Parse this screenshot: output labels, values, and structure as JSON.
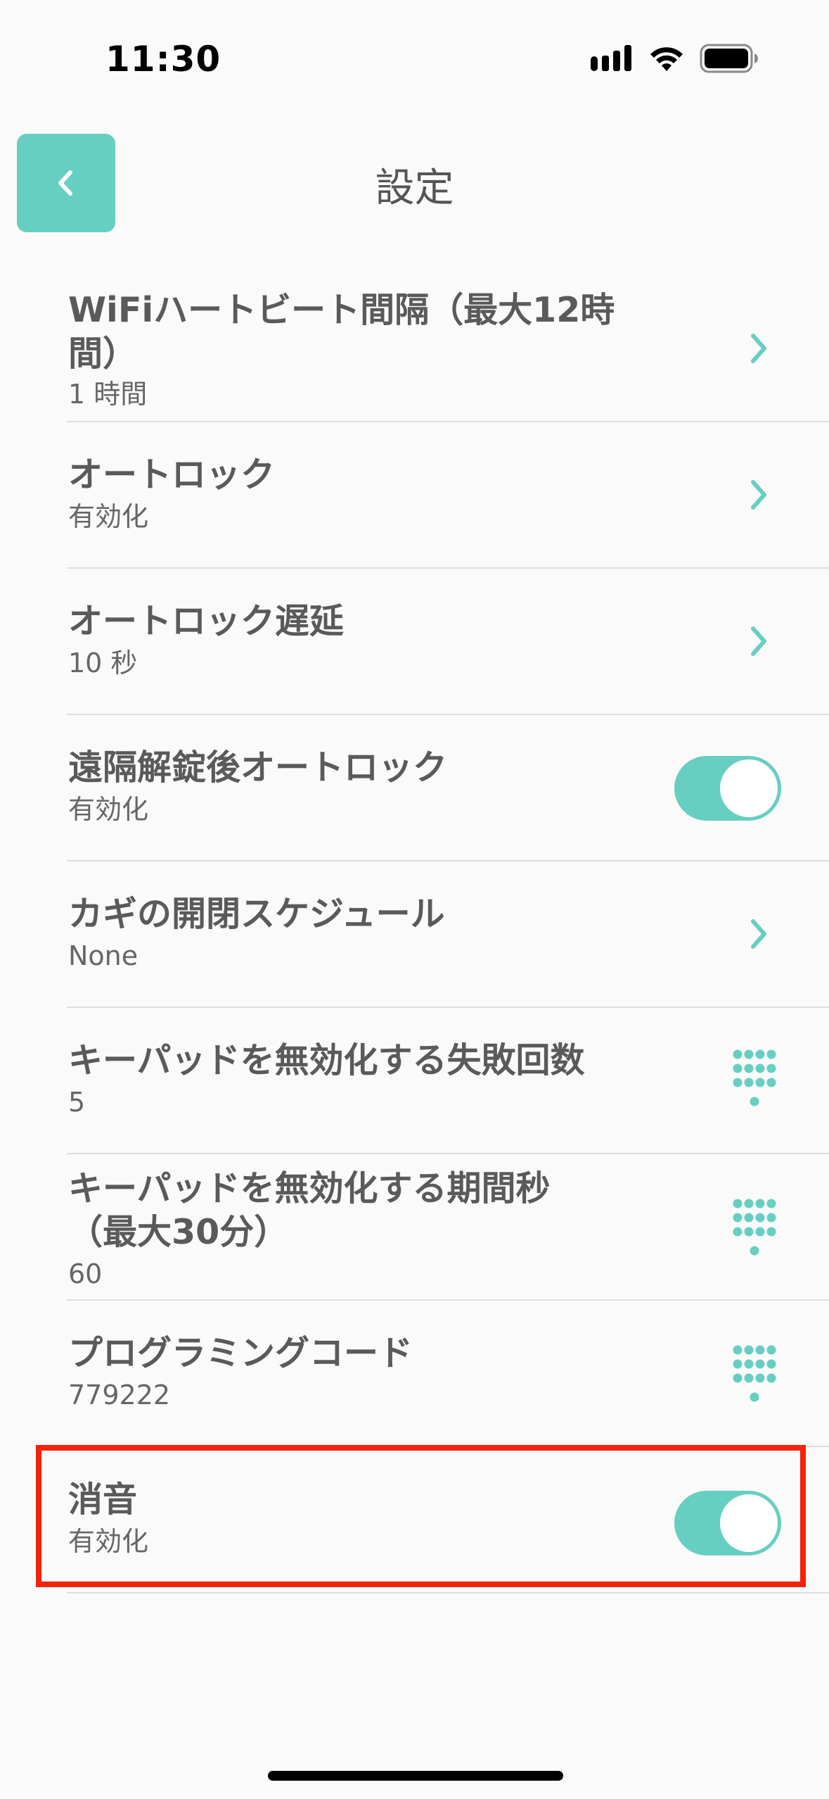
{
  "status_bar": {
    "time": "11:30"
  },
  "header": {
    "title": "設定",
    "back_icon": "chevron-left-icon"
  },
  "colors": {
    "accent": "#66cfc1",
    "highlight": "#f4220a",
    "text": "#5a5a5a"
  },
  "settings": [
    {
      "title": "WiFiハートビート間隔（最大12時間）",
      "value": "1 時間",
      "control": "chevron"
    },
    {
      "title": "オートロック",
      "value": "有効化",
      "control": "chevron"
    },
    {
      "title": "オートロック遅延",
      "value": "10 秒",
      "control": "chevron"
    },
    {
      "title": "遠隔解錠後オートロック",
      "value": "有効化",
      "control": "toggle",
      "on": true
    },
    {
      "title": "カギの開閉スケジュール",
      "value": "None",
      "control": "chevron"
    },
    {
      "title": "キーパッドを無効化する失敗回数",
      "value": "5",
      "control": "keypad"
    },
    {
      "title": "キーパッドを無効化する期間秒（最大30分）",
      "value": "60",
      "control": "keypad"
    },
    {
      "title": "プログラミングコード",
      "value": "779222",
      "control": "keypad"
    },
    {
      "title": "消音",
      "value": "有効化",
      "control": "toggle",
      "on": true,
      "highlighted": true
    }
  ]
}
